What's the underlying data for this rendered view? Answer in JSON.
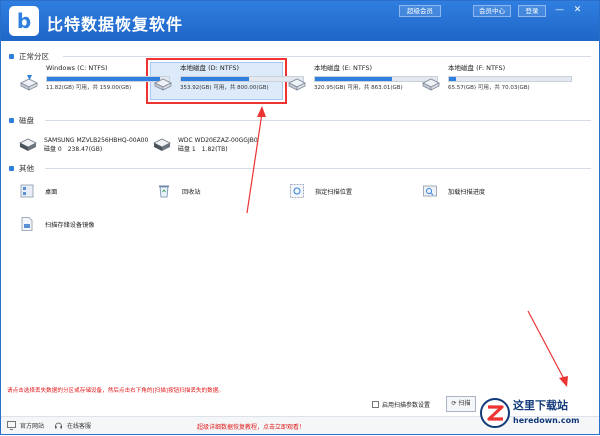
{
  "app": {
    "title": "比特数据恢复软件",
    "top_buttons": [
      "超级会员",
      "会员中心",
      "登录"
    ]
  },
  "sections": {
    "partitions": "正常分区",
    "disks": "磁盘",
    "others": "其他"
  },
  "drives": [
    {
      "name": "Windows (C: NTFS)",
      "space": "11.82(GB) 可用，共 159.00(GB)",
      "used_fraction": 0.93
    },
    {
      "name": "本地磁盘 (D: NTFS)",
      "space": "353.92(GB) 可用，共 800.00(GB)",
      "used_fraction": 0.56
    },
    {
      "name": "本地磁盘 (E: NTFS)",
      "space": "320.95(GB) 可用，共 863.01(GB)",
      "used_fraction": 0.63
    },
    {
      "name": "本地磁盘 (F: NTFS)",
      "space": "65.57(GB) 可用，共 70.03(GB)",
      "used_fraction": 0.06
    }
  ],
  "disks": [
    {
      "name": "SAMSUNG MZVLB256HBHQ-00A00",
      "info": "磁盘 0　238.47(GB)"
    },
    {
      "name": "WDC WD20EZAZ-00GGJB0",
      "info": "磁盘 1　1.82(TB)"
    }
  ],
  "others": [
    {
      "label": "桌面",
      "icon": "desktop-icon"
    },
    {
      "label": "回收站",
      "icon": "recycle-bin-icon"
    },
    {
      "label": "指定扫描位置",
      "icon": "location-scan-icon"
    },
    {
      "label": "加载扫描进度",
      "icon": "load-progress-icon"
    },
    {
      "label": "扫描存储设备镜像",
      "icon": "disk-image-icon"
    }
  ],
  "hint": "请点击选择丢失数据的分区或存储设备，然后点击右下角的[扫描]按钮扫描丢失的数据。",
  "options": {
    "advanced_scan": "启用扫描参数设置",
    "rescan": "扫描"
  },
  "footer": {
    "website": "官方网站",
    "support": "在线客服",
    "center_link": "超级详细数据恢复教程，点击立即观看！"
  },
  "watermark": {
    "text": "这里下载站",
    "url": "heredown.com"
  },
  "colors": {
    "accent": "#2f7fe0",
    "highlight": "#e33333",
    "hint": "#e01b1b"
  }
}
